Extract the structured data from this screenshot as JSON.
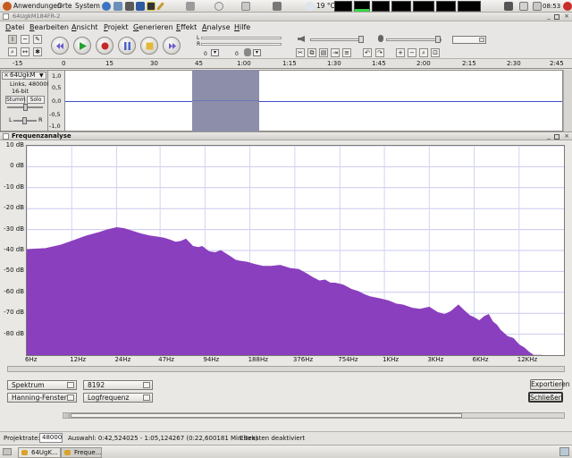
{
  "top_panel": {
    "menus": [
      "Anwendungen",
      "Orte",
      "System"
    ],
    "temperature": "19 °C",
    "clock": "08:53"
  },
  "audacity": {
    "window_title": "64UgkM184FR-2",
    "menus": [
      "Datei",
      "Bearbeiten",
      "Ansicht",
      "Projekt",
      "Generieren",
      "Effekt",
      "Analyse",
      "Hilfe"
    ],
    "meter_L": "L",
    "meter_R": "R",
    "meter_zero_1": "0",
    "meter_zero_2": "0",
    "timeline_ticks": [
      "-15",
      "0",
      "15",
      "30",
      "45",
      "1:00",
      "1:15",
      "1:30",
      "1:45",
      "2:00",
      "2:15",
      "2:30",
      "2:45"
    ],
    "track": {
      "name": "64UgkM",
      "info_line1": "Links, 48000Hz",
      "info_line2": "16-bit",
      "mute_label": "Stumm",
      "solo_label": "Solo",
      "pan_L": "L",
      "pan_R": "R",
      "scale": [
        "1,0",
        "0,5",
        "0,0",
        "-0,5",
        "-1,0"
      ]
    }
  },
  "freq_dialog": {
    "title": "Frequenzanalyse",
    "algorithm": "Spektrum",
    "size": "8192",
    "function": "Hanning-Fenster",
    "axis": "Logfrequenz",
    "export_label": "Exportieren",
    "close_label": "Schließen"
  },
  "chart_data": {
    "type": "area",
    "title": "",
    "xlabel": "",
    "ylabel": "",
    "x_scale": "log",
    "xlim": [
      6,
      24000
    ],
    "ylim": [
      -90,
      10
    ],
    "grid": true,
    "color": "#8a3fbe",
    "y_tick_labels": [
      "10 dB",
      "0 dB",
      "-10 dB",
      "-20 dB",
      "-30 dB",
      "-40 dB",
      "-50 dB",
      "-60 dB",
      "-70 dB",
      "-80 dB"
    ],
    "y_ticks": [
      10,
      0,
      -10,
      -20,
      -30,
      -40,
      -50,
      -60,
      -70,
      -80
    ],
    "x_tick_labels": [
      "6Hz",
      "12Hz",
      "24Hz",
      "47Hz",
      "94Hz",
      "188Hz",
      "376Hz",
      "754Hz",
      "1KHz",
      "3KHz",
      "6KHz",
      "12KHz"
    ],
    "x_ticks": [
      6,
      12,
      24,
      47,
      94,
      188,
      376,
      754,
      1500,
      3000,
      6000,
      12000
    ],
    "series": [
      {
        "x": [
          6,
          8,
          10,
          12,
          15,
          18,
          21,
          24,
          27,
          30,
          35,
          40,
          45,
          50,
          55,
          60,
          65,
          70,
          78,
          85,
          90,
          100,
          110,
          120,
          140,
          150,
          160,
          180,
          200,
          230,
          260,
          300,
          350,
          400,
          450,
          500,
          550,
          600,
          650,
          700,
          750,
          800,
          900,
          1000,
          1100,
          1200,
          1400,
          1600,
          1800,
          2000,
          2300,
          2600,
          3000,
          3400,
          3800,
          4200,
          4700,
          5200,
          5600,
          6000,
          6500,
          7000,
          7500,
          8000,
          8500,
          9000,
          9500,
          10000,
          11000,
          12000,
          13000,
          14000,
          15000,
          16000,
          17000
        ],
        "values": [
          -39.5,
          -39,
          -37.5,
          -35.5,
          -33,
          -31.5,
          -30,
          -29,
          -29.5,
          -30.5,
          -32,
          -33,
          -33.5,
          -34,
          -35,
          -36,
          -35.5,
          -34.5,
          -38,
          -38.5,
          -38,
          -40.5,
          -41,
          -40,
          -43,
          -44.5,
          -45,
          -45.5,
          -46.5,
          -47.5,
          -47.5,
          -47,
          -48.5,
          -49,
          -51,
          -53,
          -54.5,
          -54,
          -55.5,
          -55.5,
          -56,
          -56.5,
          -58.5,
          -59.5,
          -61,
          -62,
          -63,
          -64,
          -65.5,
          -66,
          -67.5,
          -68,
          -67,
          -69.5,
          -70.5,
          -69,
          -66,
          -69,
          -71,
          -72,
          -73.5,
          -71.5,
          -70.5,
          -74,
          -75.5,
          -78,
          -79.5,
          -81,
          -82,
          -85,
          -86.5,
          -88.5,
          -90,
          -92,
          -95
        ]
      }
    ]
  },
  "status_bar": {
    "rate_label": "Projektrate:",
    "rate_value": "48000",
    "selection": "Auswahl: 0:42,524025 - 1:05,124267 (0:22,600181 Min:Sek)",
    "snap": "Einrasten deaktiviert"
  },
  "taskbar": {
    "items": [
      "64UgK...",
      "Freque..."
    ]
  }
}
